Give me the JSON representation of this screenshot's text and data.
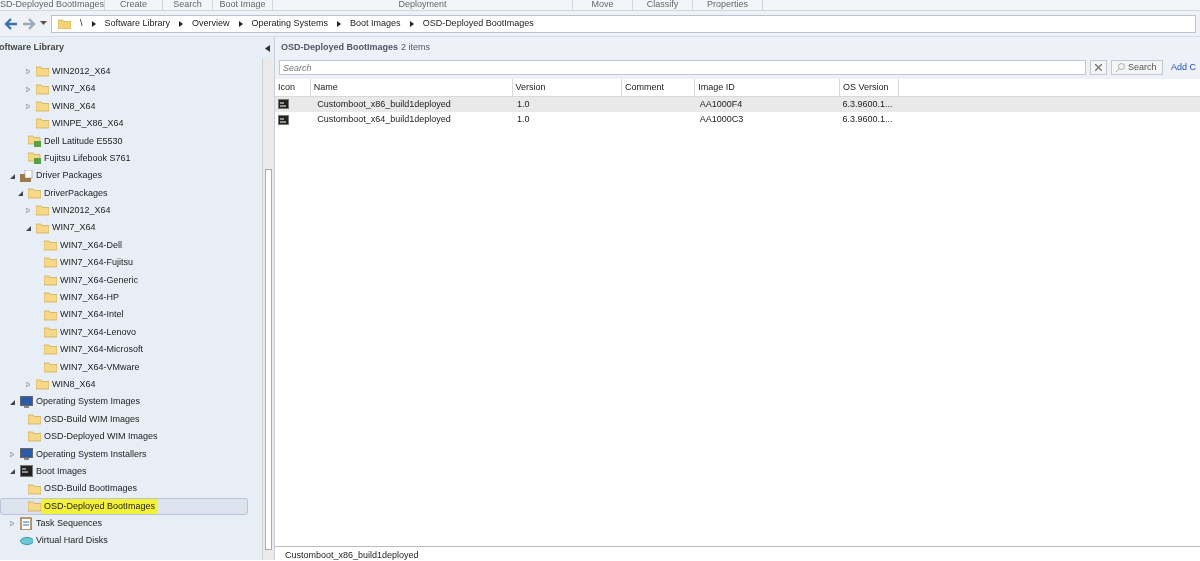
{
  "ribbon_groups": [
    "SD-Deployed BootImages",
    "Create",
    "Search",
    "Boot Image",
    "Deployment",
    "Move",
    "Classify",
    "Properties"
  ],
  "breadcrumb": [
    "\\",
    "Software Library",
    "Overview",
    "Operating Systems",
    "Boot Images",
    "OSD-Deployed BootImages"
  ],
  "navigation": {
    "title": "oftware Library",
    "tree": [
      {
        "children": [
          {
            "children": [
              {
                "label": "WIN2012_X64",
                "kind": "folder",
                "expanded": false,
                "selected": false
              },
              {
                "label": "WIN7_X64",
                "kind": "folder",
                "expanded": false,
                "selected": false
              },
              {
                "label": "WIN8_X64",
                "kind": "folder",
                "expanded": false,
                "selected": false
              },
              {
                "label": "WINPE_X86_X64",
                "kind": "folder",
                "selected": false
              }
            ]
          },
          {
            "label": "Dell Latitude E5530",
            "kind": "driver",
            "selected": false
          },
          {
            "label": "Fujitsu Lifebook S761",
            "kind": "driver",
            "selected": false
          }
        ]
      },
      {
        "label": "Driver Packages",
        "kind": "package",
        "expanded": true,
        "selected": false,
        "children": [
          {
            "label": "DriverPackages",
            "kind": "folder",
            "expanded": true,
            "selected": false,
            "children": [
              {
                "label": "WIN2012_X64",
                "kind": "folder",
                "expanded": false,
                "selected": false
              },
              {
                "label": "WIN7_X64",
                "kind": "folder",
                "expanded": true,
                "selected": false,
                "children": [
                  {
                    "label": "WIN7_X64-Dell",
                    "kind": "folder",
                    "selected": false
                  },
                  {
                    "label": "WIN7_X64-Fujitsu",
                    "kind": "folder",
                    "selected": false
                  },
                  {
                    "label": "WIN7_X64-Generic",
                    "kind": "folder",
                    "selected": false
                  },
                  {
                    "label": "WIN7_X64-HP",
                    "kind": "folder",
                    "selected": false
                  },
                  {
                    "label": "WIN7_X64-Intel",
                    "kind": "folder",
                    "selected": false
                  },
                  {
                    "label": "WIN7_X64-Lenovo",
                    "kind": "folder",
                    "selected": false
                  },
                  {
                    "label": "WIN7_X64-Microsoft",
                    "kind": "folder",
                    "selected": false
                  },
                  {
                    "label": "WIN7_X64-VMware",
                    "kind": "folder",
                    "selected": false
                  }
                ]
              },
              {
                "label": "WIN8_X64",
                "kind": "folder",
                "expanded": false,
                "selected": false
              }
            ]
          }
        ]
      },
      {
        "label": "Operating System Images",
        "kind": "monitor",
        "expanded": true,
        "selected": false,
        "children": [
          {
            "label": "OSD-Build WIM Images",
            "kind": "folder",
            "selected": false
          },
          {
            "label": "OSD-Deployed WIM Images",
            "kind": "folder",
            "selected": false
          }
        ]
      },
      {
        "label": "Operating System Installers",
        "kind": "monitor",
        "expanded": false,
        "selected": false
      },
      {
        "label": "Boot Images",
        "kind": "console",
        "expanded": true,
        "selected": false,
        "children": [
          {
            "label": "OSD-Build BootImages",
            "kind": "folder",
            "selected": false
          },
          {
            "label": "OSD-Deployed BootImages",
            "kind": "folder",
            "selected": true,
            "highlighted": true
          }
        ]
      },
      {
        "label": "Task Sequences",
        "kind": "clipboard",
        "expanded": false,
        "selected": false
      },
      {
        "label": "Virtual Hard Disks",
        "kind": "disk",
        "selected": false
      }
    ]
  },
  "content": {
    "title": "OSD-Deployed BootImages",
    "count": "2 items",
    "search": {
      "placeholder": "Search",
      "button": "Search",
      "add_link": "Add C"
    },
    "table": {
      "columns": [
        "Icon",
        "Name",
        "Version",
        "Comment",
        "Image ID",
        "OS Version"
      ],
      "rows": [
        {
          "name": "Customboot_x86_build1deployed",
          "version": "1.0",
          "image_id": "AA1000F4",
          "os_version": "6.3.9600.1...",
          "selected": true
        },
        {
          "name": "Customboot_x64_build1deployed",
          "version": "1.0",
          "image_id": "AA1000C3",
          "os_version": "6.3.9600.1...",
          "selected": false
        }
      ]
    },
    "details_title": "Customboot_x86_build1deployed"
  }
}
